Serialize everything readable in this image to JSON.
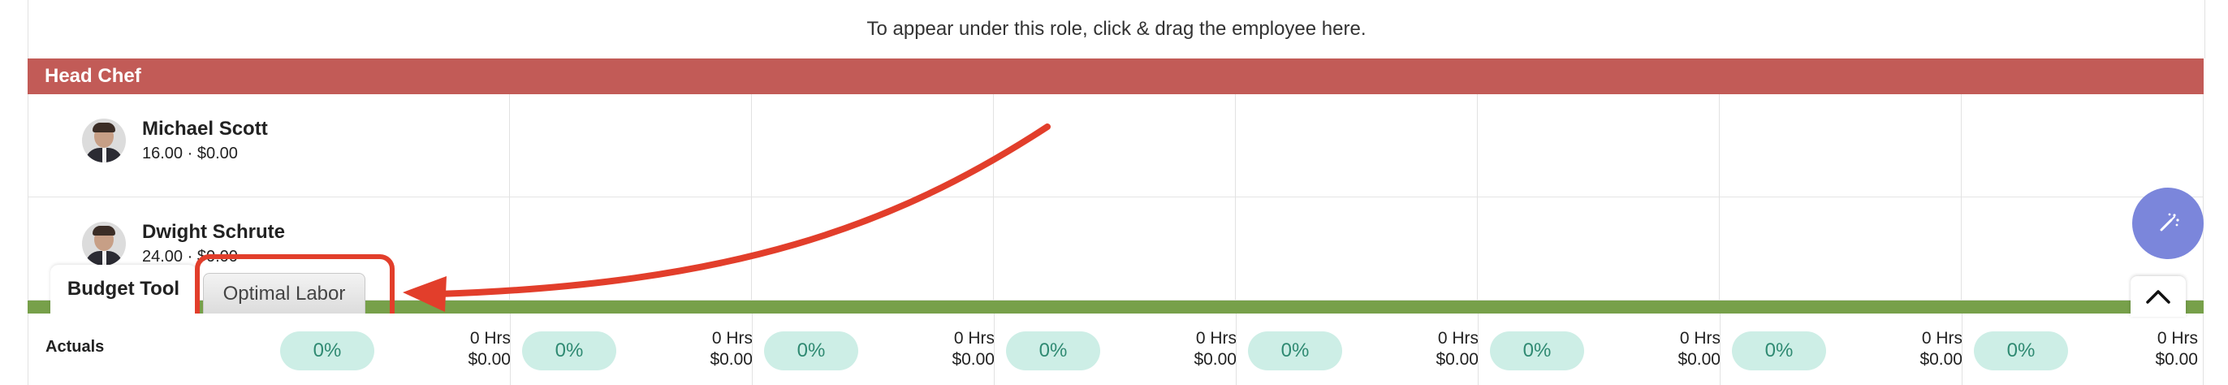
{
  "hint": "To appear under this role, click & drag the employee here.",
  "role": {
    "title": "Head Chef"
  },
  "employees": [
    {
      "name": "Michael Scott",
      "meta": "16.00 · $0.00"
    },
    {
      "name": "Dwight Schrute",
      "meta": "24.00 · $0.00"
    }
  ],
  "tabs": {
    "budget_tool": "Budget Tool",
    "optimal_labor": "Optimal Labor"
  },
  "actuals": {
    "label": "Actuals",
    "cells": [
      {
        "pct": "0%",
        "hrs": "0 Hrs",
        "cost": "$0.00"
      },
      {
        "pct": "0%",
        "hrs": "0 Hrs",
        "cost": "$0.00"
      },
      {
        "pct": "0%",
        "hrs": "0 Hrs",
        "cost": "$0.00"
      },
      {
        "pct": "0%",
        "hrs": "0 Hrs",
        "cost": "$0.00"
      },
      {
        "pct": "0%",
        "hrs": "0 Hrs",
        "cost": "$0.00"
      },
      {
        "pct": "0%",
        "hrs": "0 Hrs",
        "cost": "$0.00"
      },
      {
        "pct": "0%",
        "hrs": "0 Hrs",
        "cost": "$0.00"
      },
      {
        "pct": "0%",
        "hrs": "0 Hrs",
        "cost": "$0.00"
      }
    ]
  },
  "colors": {
    "role_bar": "#c25b57",
    "accent_green": "#77a04a",
    "fab": "#7b86db",
    "callout": "#e23e2b"
  },
  "icons": {
    "fab": "magic-wand-icon",
    "collapse": "chevron-up-icon"
  }
}
